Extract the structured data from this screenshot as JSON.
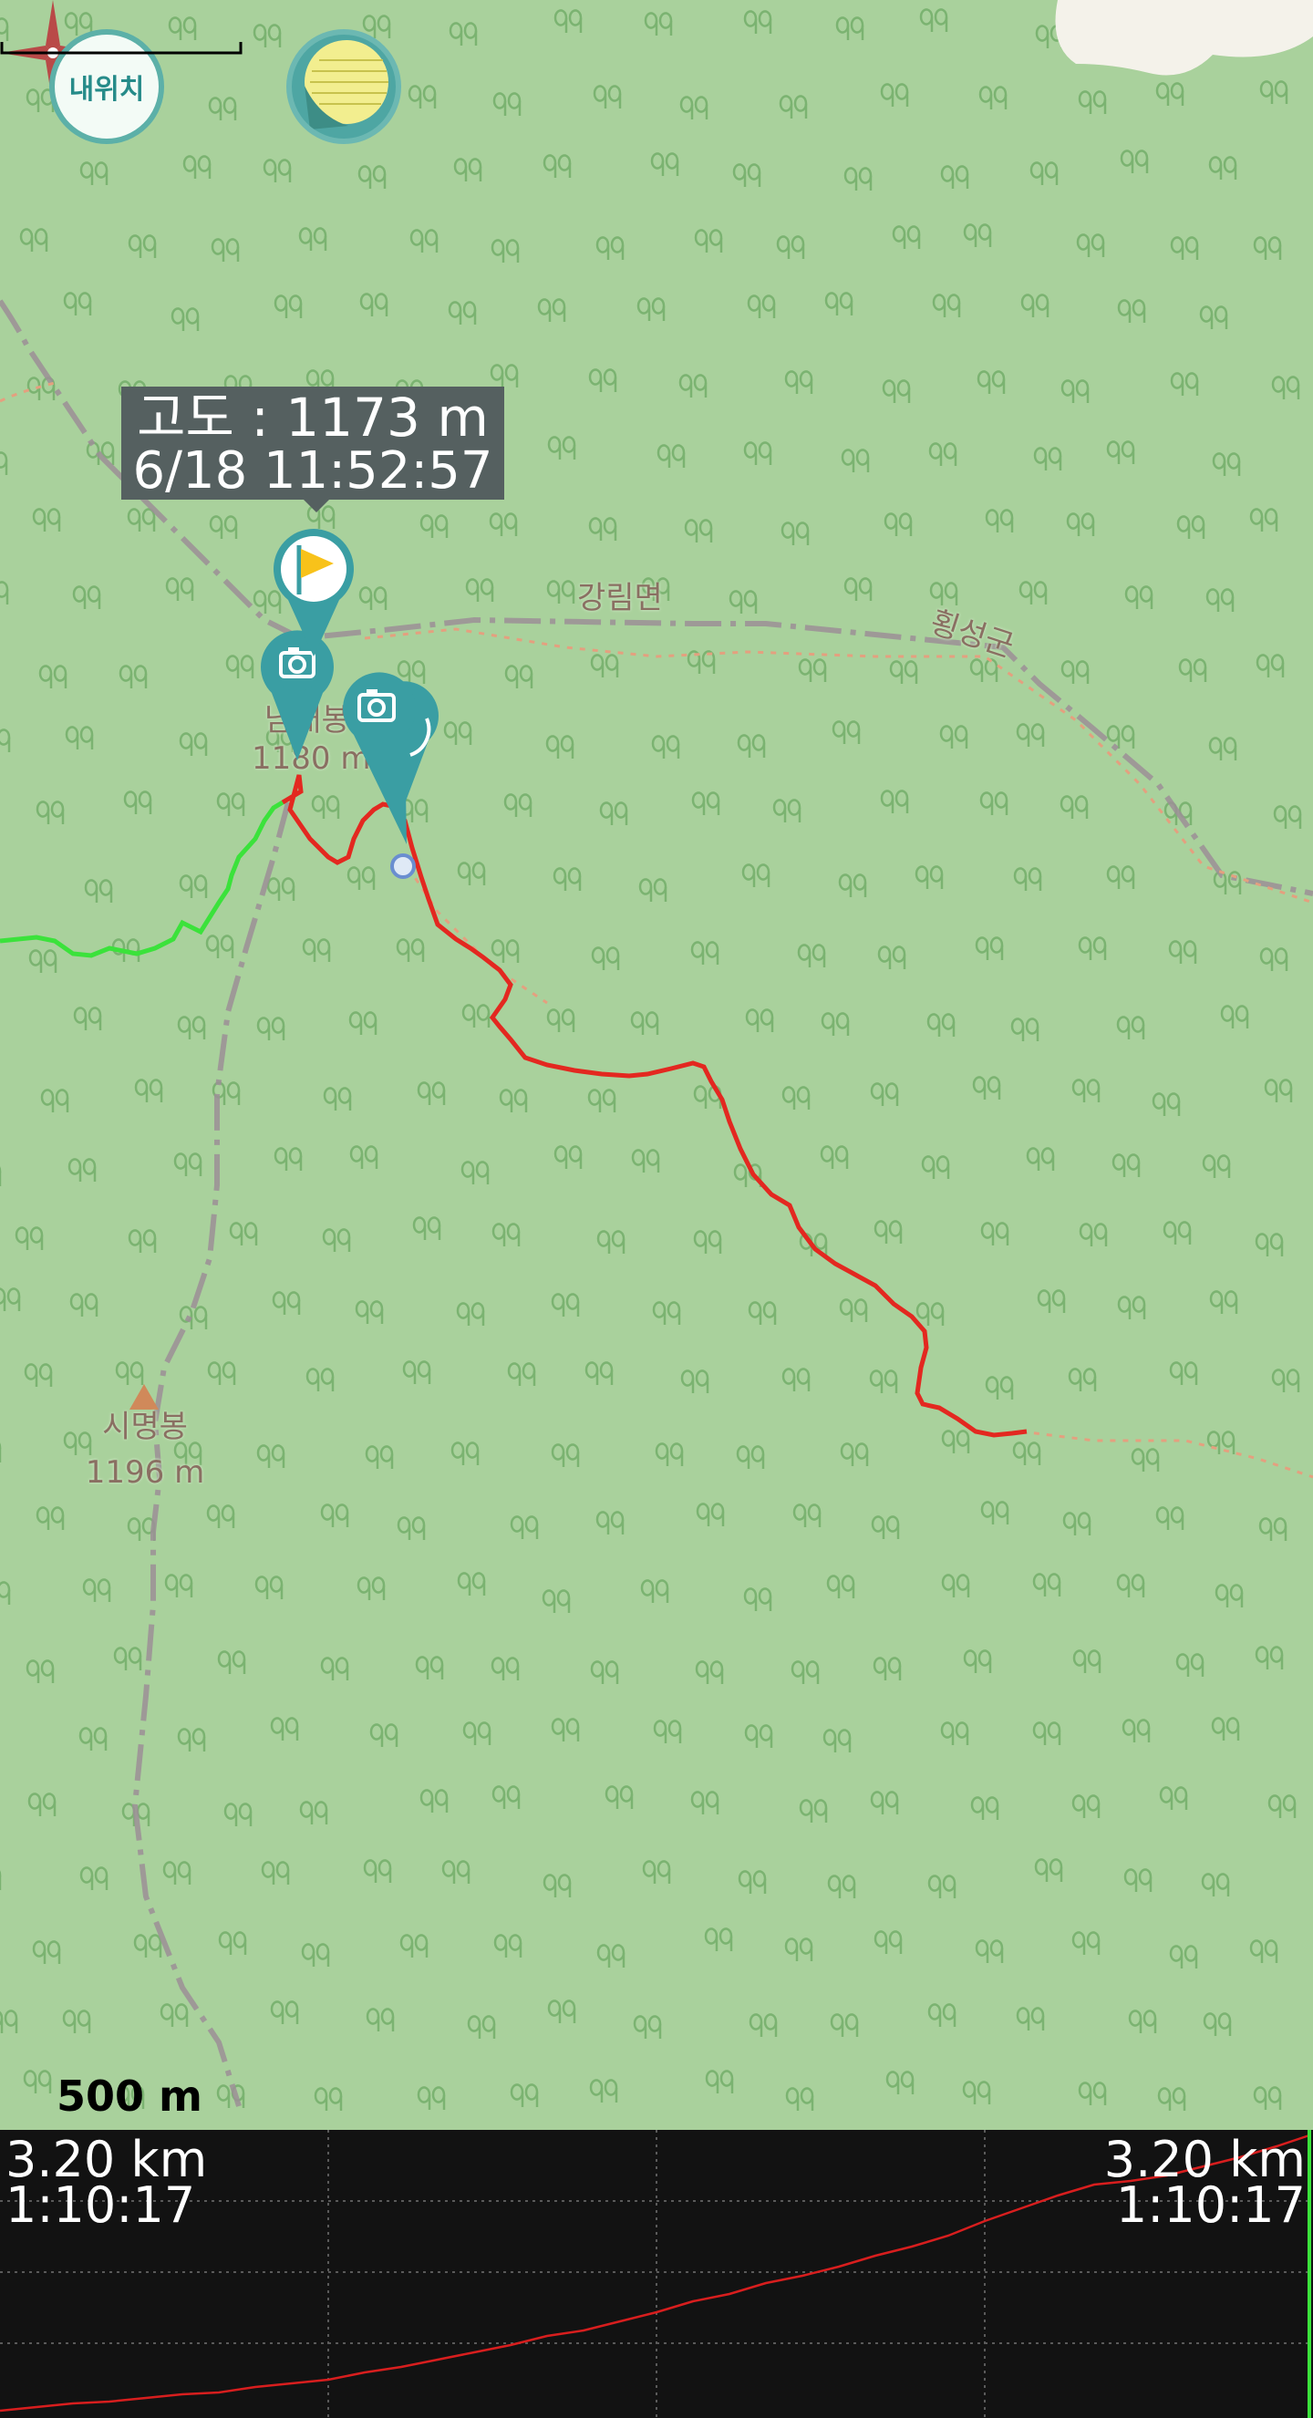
{
  "controls": {
    "my_location_label": "내위치",
    "layer_button_icon": "map-layer-icon"
  },
  "map": {
    "labels": {
      "district_1": "강림면",
      "district_2": "횡성군",
      "summit_name": "시명봉",
      "summit_elev": "1196 m",
      "start_peak_elev": "1180 m",
      "start_peak_name_partial": "남대봉"
    },
    "tooltip": {
      "altitude": "고도 : 1173 m",
      "timestamp": "6/18 11:52:57"
    },
    "scale": "500 m",
    "colors": {
      "map_bg": "#a9d19c",
      "track_recorded": "#e32820",
      "track_previous": "#3be23b",
      "marker": "#3a9ea3",
      "boundary": "#9c8f96"
    },
    "markers": [
      "flag-marker",
      "camera-marker",
      "camera-marker",
      "camera-marker"
    ]
  },
  "elevation_profile": {
    "left": {
      "distance": "3.20 km",
      "duration": "1:10:17"
    },
    "right": {
      "distance": "3.20 km",
      "duration": "1:10:17"
    },
    "line_color": "#d81e1e",
    "grid": true
  }
}
